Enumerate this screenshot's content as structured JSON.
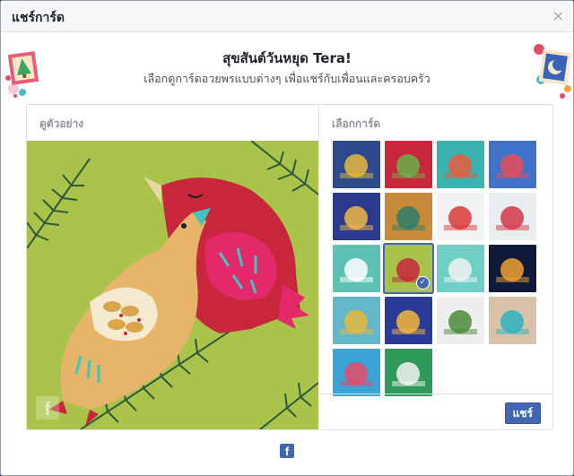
{
  "dialog": {
    "title": "แชร์การ์ด",
    "close_icon": "×"
  },
  "header": {
    "title": "สุขสันต์วันหยุด Tera!",
    "subtitle": "เลือกดูการ์ดอวยพรแบบต่างๆ เพื่อแชร์กับเพื่อนและครอบครัว"
  },
  "preview": {
    "label": "ดูตัวอย่าง",
    "watermark": "f"
  },
  "selector": {
    "label": "เลือกการ์ด",
    "thumbnails": [
      {
        "name": "card-blue-trees",
        "color": "#2f4a8a",
        "accent": "#e8b93c"
      },
      {
        "name": "card-cactus-santa",
        "color": "#c8263a",
        "accent": "#6bb34a"
      },
      {
        "name": "card-teal-ornaments",
        "color": "#3bb3b0",
        "accent": "#e85c3c"
      },
      {
        "name": "card-blue-tree-lights",
        "color": "#3e73c9",
        "accent": "#e74c5a"
      },
      {
        "name": "card-blue-gifts",
        "color": "#2b3a8f",
        "accent": "#f0b848"
      },
      {
        "name": "card-knit-pattern",
        "color": "#c98b3a",
        "accent": "#2e7d6a"
      },
      {
        "name": "card-paper-snowman",
        "color": "#f2f2f2",
        "accent": "#d93a3a"
      },
      {
        "name": "card-string-lights",
        "color": "#e9eef0",
        "accent": "#d4374a"
      },
      {
        "name": "card-menorah-cup",
        "color": "#5dc2b2",
        "accent": "#ffffff"
      },
      {
        "name": "card-birds",
        "color": "#a8c24a",
        "accent": "#c8263a"
      },
      {
        "name": "card-snow-globe",
        "color": "#6fcfc4",
        "accent": "#f2f2f2"
      },
      {
        "name": "card-fireworks",
        "color": "#0f1a3a",
        "accent": "#f0a030"
      },
      {
        "name": "card-gold-coins",
        "color": "#62b8c9",
        "accent": "#e8b93c"
      },
      {
        "name": "card-mosque-arch",
        "color": "#2a3b9a",
        "accent": "#f5b93a"
      },
      {
        "name": "card-wreath-angel",
        "color": "#eeeeee",
        "accent": "#4a8a3a"
      },
      {
        "name": "card-sand-angel",
        "color": "#d9c3a8",
        "accent": "#2bb3c0"
      },
      {
        "name": "card-paper-stars",
        "color": "#3ba3d6",
        "accent": "#e84c6a"
      },
      {
        "name": "card-vintage-van",
        "color": "#2e9a5a",
        "accent": "#f2f2f2"
      }
    ],
    "selected_index": 9,
    "selected_check": "✓"
  },
  "footer": {
    "share_label": "แชร์",
    "fb_logo": "f"
  }
}
